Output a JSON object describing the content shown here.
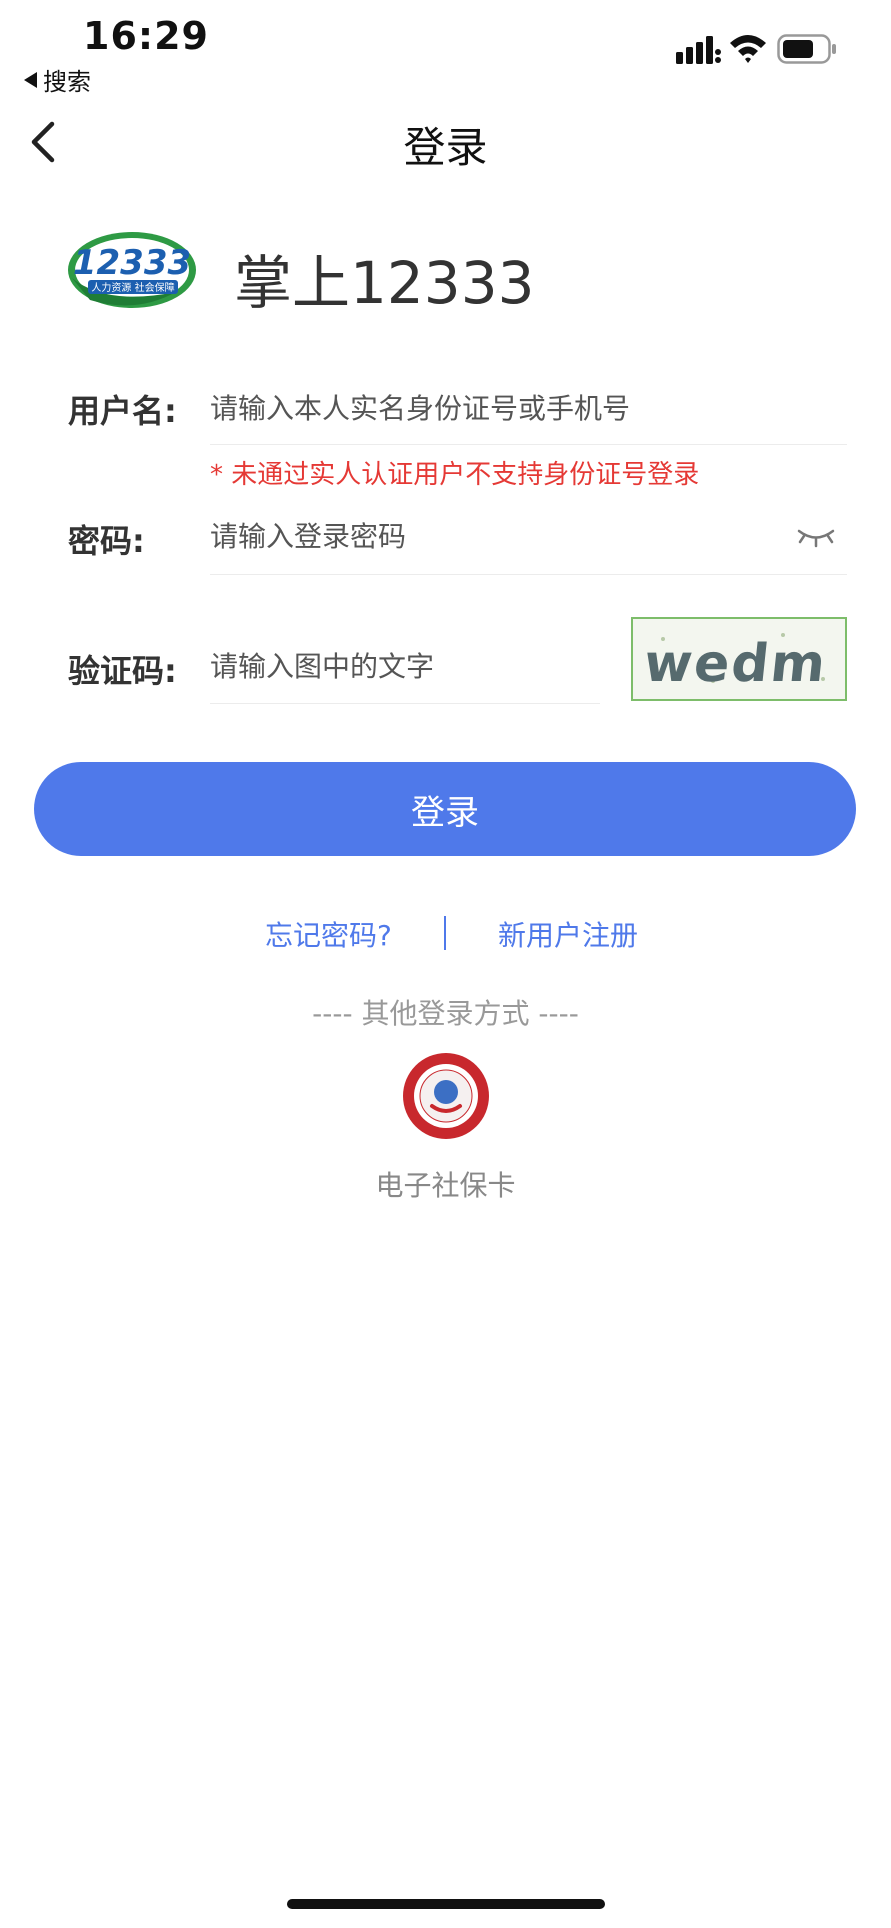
{
  "status_bar": {
    "time": "16:29",
    "back_app": "搜索",
    "icons": [
      "signal-icon",
      "wifi-icon",
      "battery-icon"
    ]
  },
  "nav": {
    "title": "登录",
    "back_icon": "chevron-left-icon"
  },
  "brand": {
    "logo_text": "12333",
    "logo_subtext": "人力资源  社会保障",
    "name": "掌上12333"
  },
  "form": {
    "username": {
      "label": "用户名:",
      "value": "",
      "placeholder": "请输入本人实名身份证号或手机号"
    },
    "warning": "* 未通过实人认证用户不支持身份证号登录",
    "password": {
      "label": "密码:",
      "value": "",
      "placeholder": "请输入登录密码",
      "toggle_icon": "eye-closed-icon"
    },
    "captcha": {
      "label": "验证码:",
      "value": "",
      "placeholder": "请输入图中的文字",
      "image_text": "wedm"
    }
  },
  "actions": {
    "login_label": "登录",
    "forgot_password": "忘记密码?",
    "register": "新用户注册"
  },
  "other_login": {
    "heading": "---- 其他登录方式 ----",
    "items": [
      {
        "label": "电子社保卡",
        "icon": "social-security-card-icon"
      }
    ]
  },
  "colors": {
    "primary": "#4f79ea",
    "warning": "#e53935",
    "captcha_border": "#7dbd6a",
    "card_red": "#c8282d"
  }
}
